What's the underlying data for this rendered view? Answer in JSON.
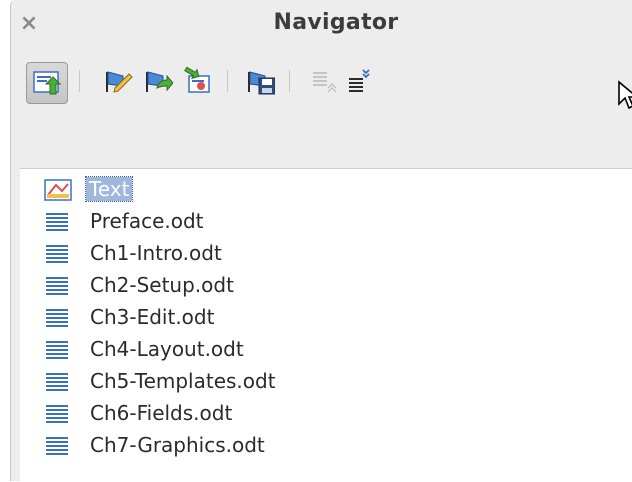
{
  "window": {
    "title": "Navigator",
    "close_glyph": "×"
  },
  "toolbar": {
    "buttons": [
      {
        "icon": "toggle-icon"
      },
      {
        "icon": "edit-icon"
      },
      {
        "icon": "update-icon"
      },
      {
        "icon": "insert-icon"
      },
      {
        "icon": "save-as-icon"
      },
      {
        "icon": "move-up-icon"
      },
      {
        "icon": "move-down-icon"
      }
    ]
  },
  "tree": {
    "root": {
      "label": "Text",
      "icon": "text-icon"
    },
    "items": [
      {
        "label": "Preface.odt",
        "icon": "document-lines-icon"
      },
      {
        "label": "Ch1-Intro.odt",
        "icon": "document-lines-icon"
      },
      {
        "label": "Ch2-Setup.odt",
        "icon": "document-lines-icon"
      },
      {
        "label": "Ch3-Edit.odt",
        "icon": "document-lines-icon"
      },
      {
        "label": "Ch4-Layout.odt",
        "icon": "document-lines-icon"
      },
      {
        "label": "Ch5-Templates.odt",
        "icon": "document-lines-icon"
      },
      {
        "label": "Ch6-Fields.odt",
        "icon": "document-lines-icon"
      },
      {
        "label": "Ch7-Graphics.odt",
        "icon": "document-lines-icon"
      }
    ]
  },
  "colors": {
    "selection": "#9fb7dc",
    "panel_bg": "#ededed",
    "icon_blue": "#3a6fc4"
  }
}
